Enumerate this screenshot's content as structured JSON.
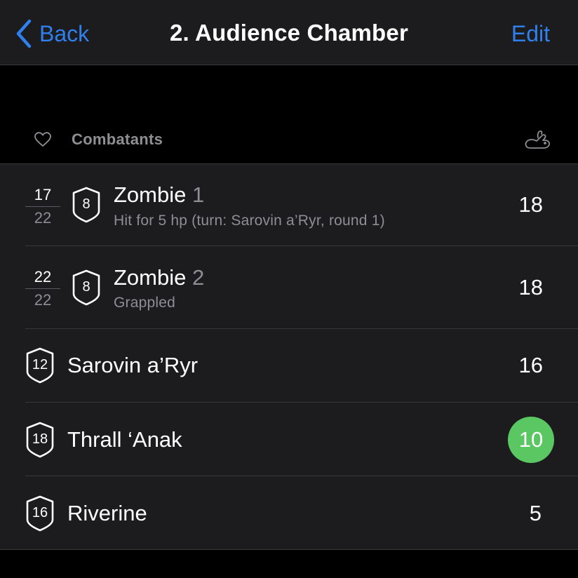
{
  "nav": {
    "back_label": "Back",
    "title": "2. Audience Chamber",
    "edit_label": "Edit"
  },
  "section": {
    "title": "Combatants",
    "icons": [
      "heart-icon",
      "rabbit-icon"
    ]
  },
  "combatants": [
    {
      "hp_current": "17",
      "hp_max": "22",
      "ac": "8",
      "name": "Zombie",
      "number": "1",
      "status": "Hit for 5 hp (turn: Sarovin a’Ryr, round 1)",
      "initiative": "18",
      "active": false
    },
    {
      "hp_current": "22",
      "hp_max": "22",
      "ac": "8",
      "name": "Zombie",
      "number": "2",
      "status": "Grappled",
      "initiative": "18",
      "active": false
    },
    {
      "ac": "12",
      "name": "Sarovin a’Ryr",
      "initiative": "16",
      "active": false
    },
    {
      "ac": "18",
      "name": "Thrall ‘Anak",
      "initiative": "10",
      "active": true
    },
    {
      "ac": "16",
      "name": "Riverine",
      "initiative": "5",
      "active": false
    }
  ],
  "colors": {
    "accent": "#2f80ed",
    "active_turn": "#5ac762",
    "background": "#000000",
    "cell": "#1c1c1e",
    "secondary_text": "#8e8e93"
  }
}
